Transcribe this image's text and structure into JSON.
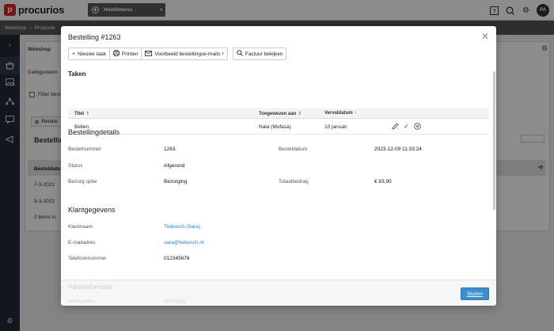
{
  "app": {
    "name": "procurios",
    "mark": "p"
  },
  "topbar": {
    "menu_label": "Hoofdmenu",
    "avatar_initials": "PA"
  },
  "breadcrumb": [
    "Webshop",
    "›",
    "Producte"
  ],
  "background": {
    "panel_title": "Webshop",
    "categories_label": "Categorieën",
    "filter_label": "Filter best",
    "relations_button": "Relatie",
    "orders_heading": "Bestelling",
    "table_header": "Besteldatu",
    "rows": [
      "7-3-2022",
      "9-3-2022"
    ],
    "count_text": "2 items in",
    "header_right": "-e"
  },
  "modal": {
    "title": "Bestelling #1263",
    "toolbar": {
      "new_task": "Nieuwe taak",
      "print": "Printen",
      "example_mails": "Voorbeeld bestellingse-mails",
      "view_invoice": "Factuur bekijken"
    },
    "tasks": {
      "heading": "Taken",
      "columns": [
        "Titel",
        "Toegewezen aan",
        "Vervaldatum"
      ],
      "column_sort": [
        "⬍",
        "⬍",
        "↑"
      ],
      "rows": [
        {
          "title": "Bellen",
          "assigned": "Nala (Mufasa)",
          "due": "10 januari"
        }
      ]
    },
    "order_details": {
      "heading": "Bestellingdetails",
      "order_number_label": "Bestelnummer",
      "order_number": "1263",
      "order_date_label": "Besteldatum",
      "order_date": "2023-12-09 11:33:24",
      "status_label": "Status",
      "status": "Afgerond",
      "delivery_label": "Bezorg optie",
      "delivery": "Bezorging",
      "total_label": "Totaalbedrag",
      "total": "€ 83,90"
    },
    "customer": {
      "heading": "Klantgegevens",
      "name_label": "Klantnaam",
      "name": "Tiebosch (Sara)",
      "email_label": "E-mailadres",
      "email": "sara@tiebosch.nl",
      "phone_label": "Telefoonnummer",
      "phone": "012345678"
    },
    "address_heading_faded": "Adresinformatie",
    "address_row_faded_label": "Bezorgadres",
    "address_row_faded_value": "Bezorging",
    "close_button": "Sluiten"
  },
  "colors": {
    "accent": "#3b8fd0",
    "link": "#2b82c9",
    "brand": "#e2231a"
  }
}
